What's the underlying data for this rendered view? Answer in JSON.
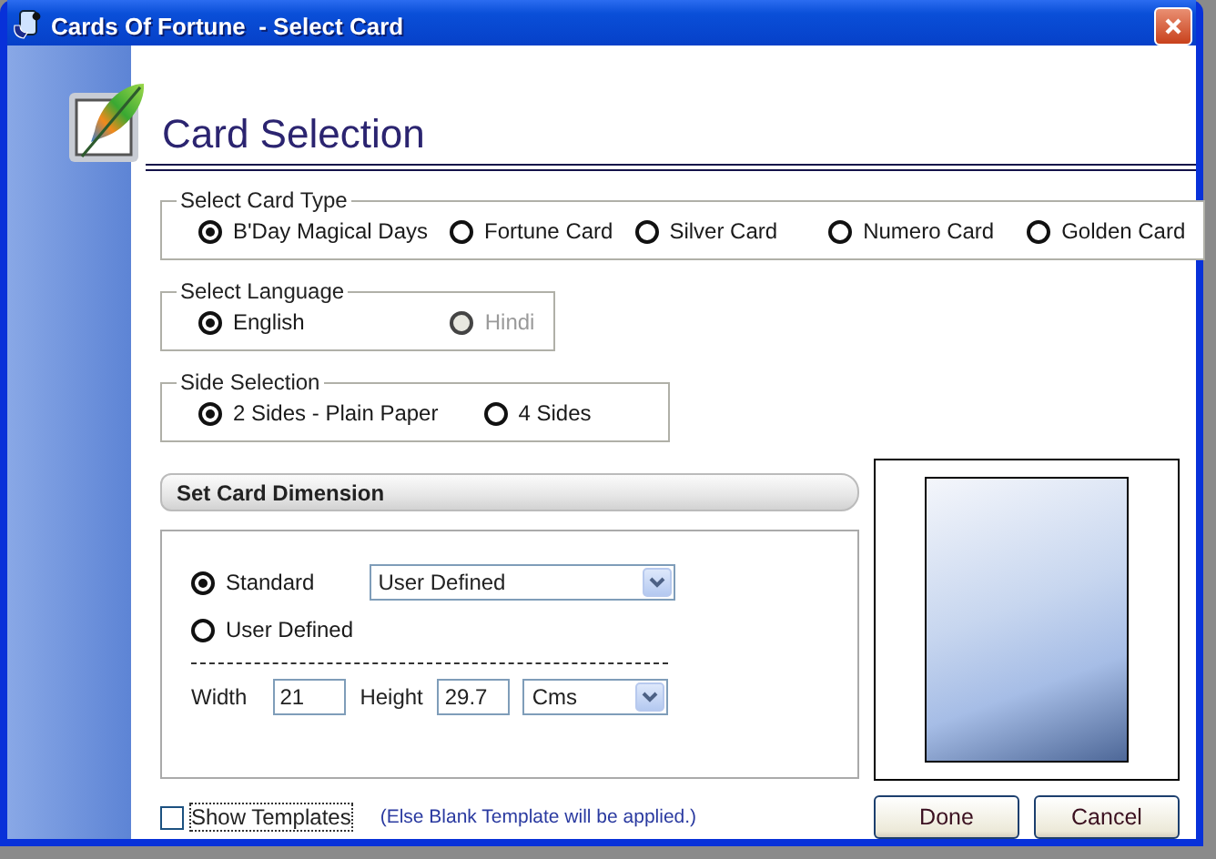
{
  "window": {
    "title": "Cards Of Fortune  - Select Card"
  },
  "header": {
    "title": "Card Selection"
  },
  "card_type": {
    "legend": "Select Card Type",
    "options": [
      {
        "label": "B'Day Magical Days",
        "selected": true
      },
      {
        "label": "Fortune Card",
        "selected": false
      },
      {
        "label": "Silver Card",
        "selected": false
      },
      {
        "label": "Numero Card",
        "selected": false
      },
      {
        "label": "Golden Card",
        "selected": false
      }
    ]
  },
  "language": {
    "legend": "Select Language",
    "options": [
      {
        "label": "English",
        "selected": true,
        "disabled": false
      },
      {
        "label": "Hindi",
        "selected": false,
        "disabled": true
      }
    ]
  },
  "side_selection": {
    "legend": "Side Selection",
    "options": [
      {
        "label": "2 Sides - Plain Paper",
        "selected": true
      },
      {
        "label": "4 Sides",
        "selected": false
      }
    ]
  },
  "card_dimension": {
    "heading": "Set Card Dimension",
    "modes": [
      {
        "label": "Standard",
        "selected": true
      },
      {
        "label": "User Defined",
        "selected": false
      }
    ],
    "standard_size": {
      "value": "User Defined"
    },
    "width": {
      "label": "Width",
      "value": "21"
    },
    "height": {
      "label": "Height",
      "value": "29.7"
    },
    "unit": {
      "value": "Cms"
    }
  },
  "show_templates": {
    "label": "Show Templates",
    "checked": false,
    "note": "(Else Blank Template will be applied.)"
  },
  "buttons": [
    {
      "label": "Done"
    },
    {
      "label": "Cancel"
    }
  ]
}
